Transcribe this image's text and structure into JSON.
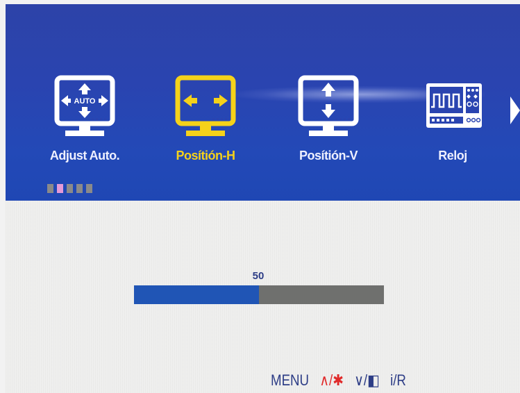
{
  "osd": {
    "menu_items": [
      {
        "label": "Adjust Auto.",
        "icon": "auto-adjust-icon",
        "selected": false,
        "icon_text": "AUTO"
      },
      {
        "label": "Posítión-H",
        "icon": "horizontal-position-icon",
        "selected": true
      },
      {
        "label": "Posítión-V",
        "icon": "vertical-position-icon",
        "selected": false
      },
      {
        "label": "Reloj",
        "icon": "clock-icon",
        "selected": false
      }
    ],
    "more_indicator_icon": "chevron-right-icon",
    "page_count": 5,
    "active_page": 2,
    "slider": {
      "value": "50",
      "fraction": 0.5
    },
    "footer": {
      "menu_key": "MENU",
      "up_key": "∧/✱",
      "down_key": "∨/◧",
      "info_key": "i/R"
    },
    "colors": {
      "header_blue": "#2a44b0",
      "selected_yellow": "#f5d21a",
      "slider_fill": "#2055b5",
      "slider_track": "#6f706e",
      "key_red": "#e02a2a",
      "text_dark_blue": "#2d3d86"
    }
  }
}
